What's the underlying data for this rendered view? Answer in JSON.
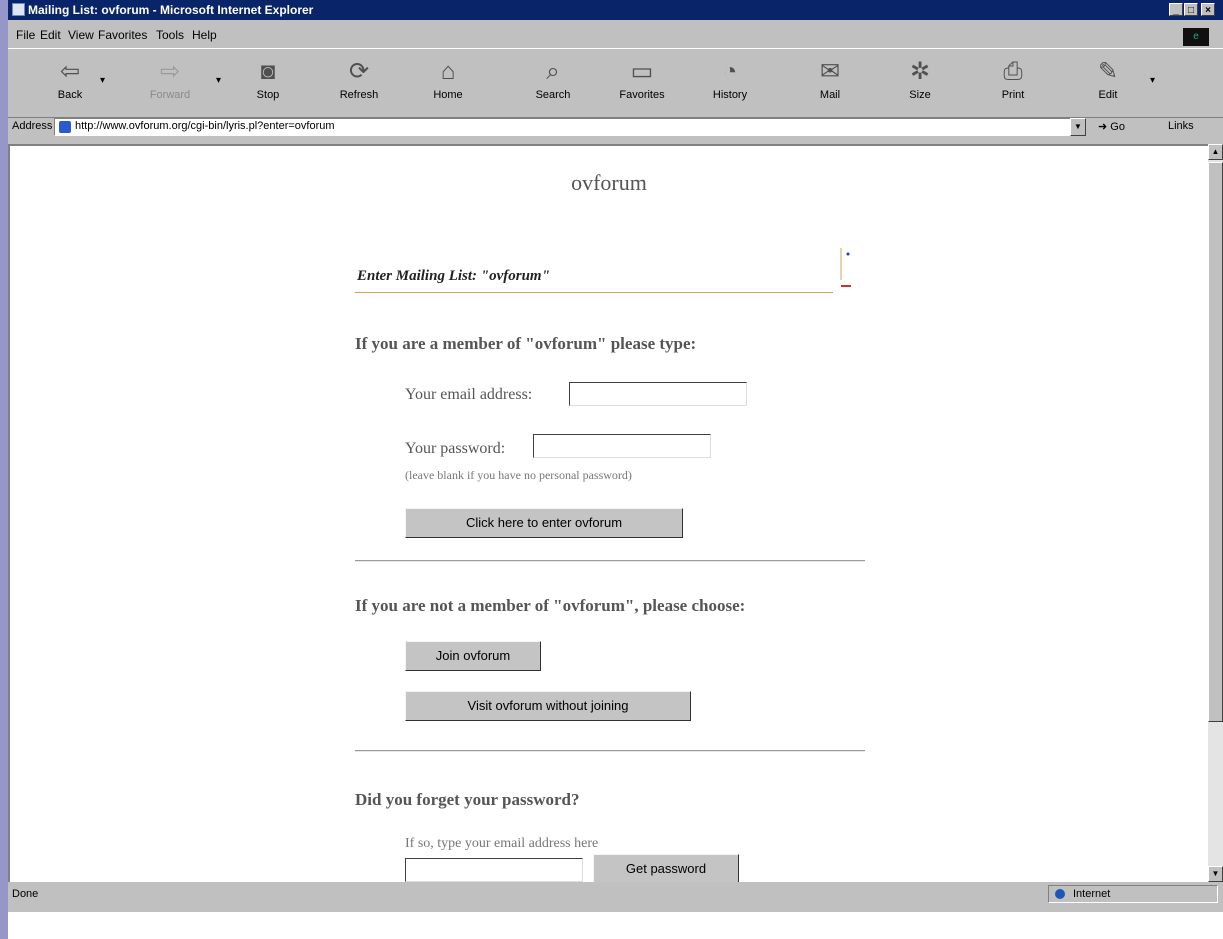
{
  "window": {
    "title": "Mailing List: ovforum - Microsoft Internet Explorer",
    "minimize": "_",
    "maximize": "□",
    "close": "×"
  },
  "menu": [
    "File",
    "Edit",
    "View",
    "Favorites",
    "Tools",
    "Help"
  ],
  "toolbar": {
    "back": "Back",
    "forward": "Forward",
    "stop": "Stop",
    "refresh": "Refresh",
    "home": "Home",
    "search": "Search",
    "favorites": "Favorites",
    "history": "History",
    "mail": "Mail",
    "size": "Size",
    "print": "Print",
    "edit": "Edit"
  },
  "address": {
    "label": "Address",
    "url": "http://www.ovforum.org/cgi-bin/lyris.pl?enter=ovforum",
    "go": "Go",
    "links": "Links"
  },
  "page": {
    "title": "ovforum",
    "banner": "Enter Mailing List: \"ovforum\"",
    "member_heading": "If you are a member of \"ovforum\" please type:",
    "email_label": "Your email address:",
    "password_label": "Your password:",
    "password_note": "(leave blank if you have no personal password)",
    "enter_button": "Click here to enter ovforum",
    "nonmember_heading": "If you are not a member of \"ovforum\", please choose:",
    "join_button": "Join ovforum",
    "visit_button": "Visit ovforum without joining",
    "forgot_heading": "Did you forget your password?",
    "forgot_note": "If so, type your email address here",
    "get_password_button": "Get password"
  },
  "status": {
    "text": "Done",
    "zone": "Internet"
  }
}
